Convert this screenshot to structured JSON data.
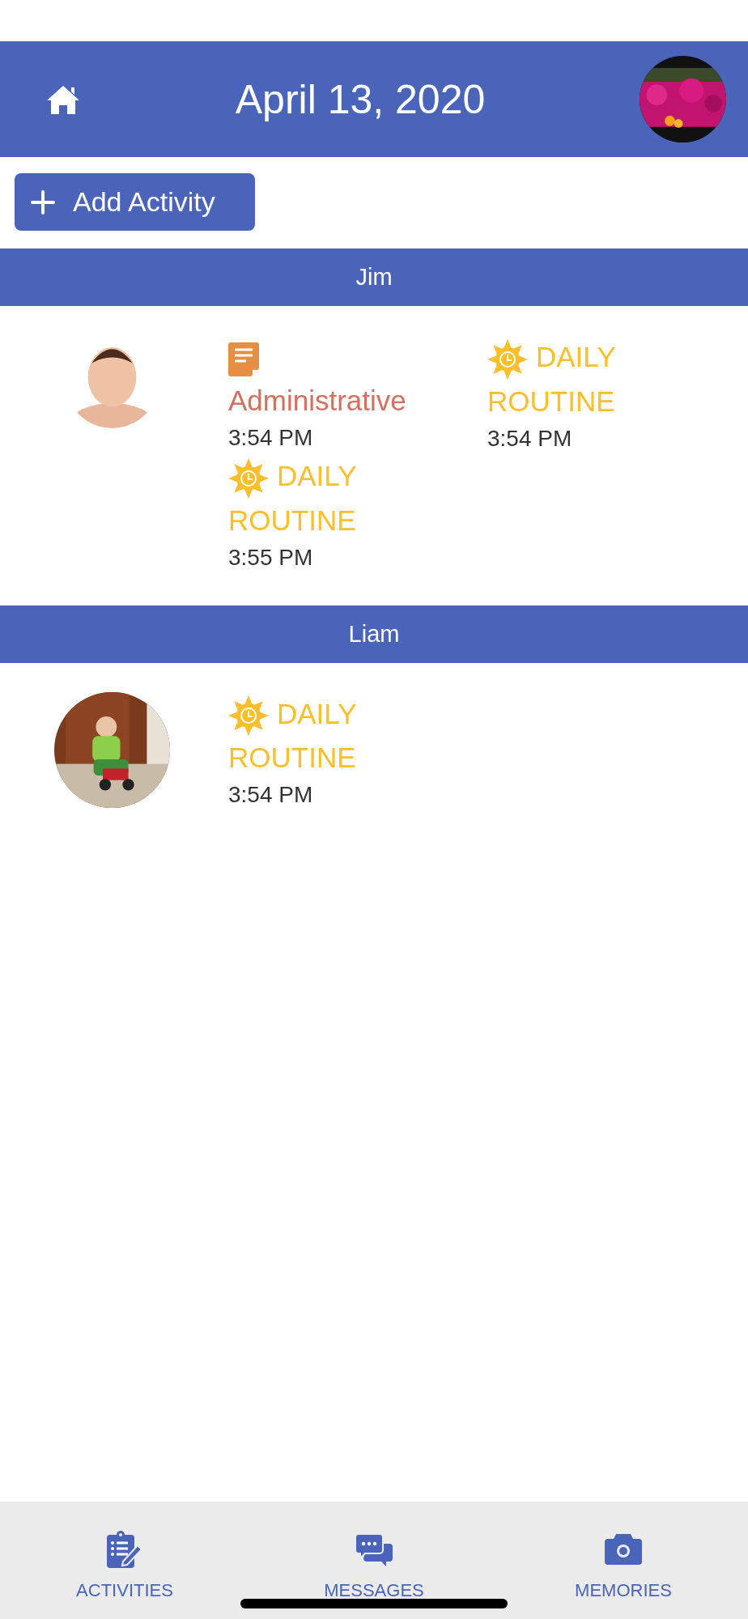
{
  "header": {
    "title": "April 13, 2020",
    "avatar": {
      "kind": "picture"
    }
  },
  "add_button": {
    "label": "Add Activity"
  },
  "groups": [
    {
      "name": "Jim",
      "avatar": {
        "kind": "picture"
      },
      "activities": [
        {
          "kind": "administrative",
          "title": "Administrative",
          "time": "3:54 PM"
        },
        {
          "kind": "daily",
          "title": "DAILY ROUTINE",
          "time": "3:54 PM"
        },
        {
          "kind": "daily",
          "title": "DAILY ROUTINE",
          "time": "3:55 PM"
        }
      ]
    },
    {
      "name": "Liam",
      "avatar": {
        "kind": "picture"
      },
      "activities": [
        {
          "kind": "daily",
          "title": "DAILY ROUTINE",
          "time": "3:54 PM"
        }
      ]
    }
  ],
  "tab_bar": [
    {
      "kind": "activities",
      "label": "ACTIVITIES"
    },
    {
      "kind": "messages",
      "label": "MESSAGES"
    },
    {
      "kind": "memories",
      "label": "MEMORIES"
    }
  ]
}
